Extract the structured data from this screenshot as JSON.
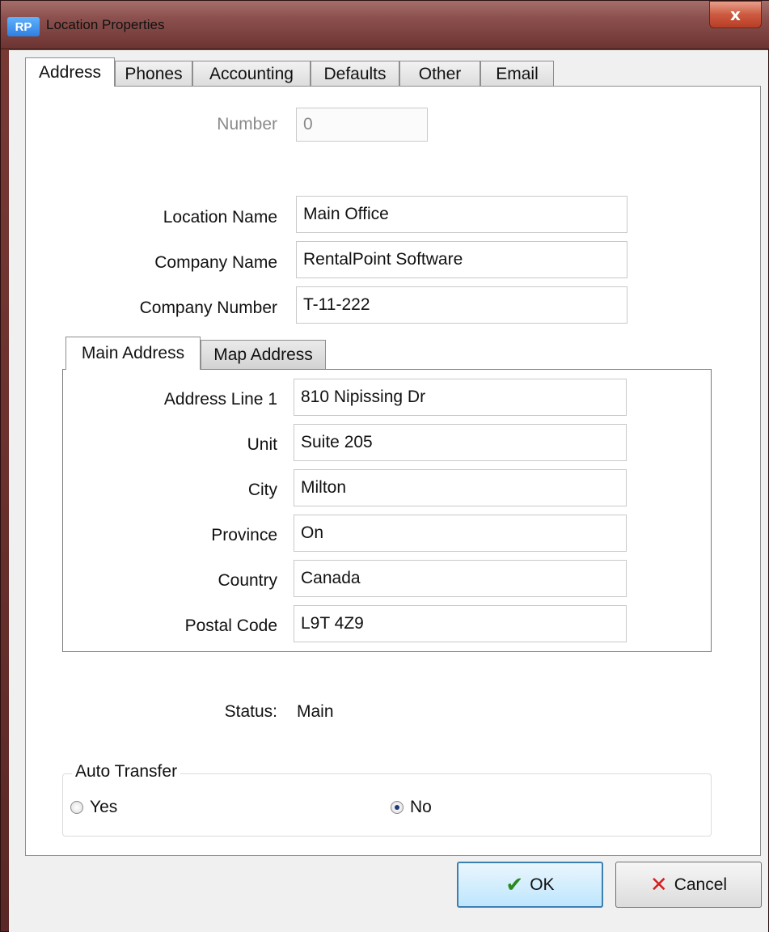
{
  "window": {
    "app_icon": "RP",
    "title": "Location Properties",
    "close_glyph": "x"
  },
  "tabs": [
    {
      "label": "Address",
      "active": true
    },
    {
      "label": "Phones",
      "active": false
    },
    {
      "label": "Accounting",
      "active": false
    },
    {
      "label": "Defaults",
      "active": false
    },
    {
      "label": "Other",
      "active": false
    },
    {
      "label": "Email",
      "active": false
    }
  ],
  "number": {
    "label": "Number",
    "value": "0"
  },
  "location_name": {
    "label": "Location Name",
    "value": "Main Office"
  },
  "company_name": {
    "label": "Company Name",
    "value": "RentalPoint Software"
  },
  "company_number": {
    "label": "Company Number",
    "value": "T-11-222"
  },
  "address_tabs": [
    {
      "label": "Main Address",
      "active": true
    },
    {
      "label": "Map Address",
      "active": false
    }
  ],
  "address": {
    "line1": {
      "label": "Address Line 1",
      "value": "810 Nipissing Dr"
    },
    "unit": {
      "label": "Unit",
      "value": "Suite 205"
    },
    "city": {
      "label": "City",
      "value": "Milton"
    },
    "province": {
      "label": "Province",
      "value": "On"
    },
    "country": {
      "label": "Country",
      "value": "Canada"
    },
    "postal_code": {
      "label": "Postal Code",
      "value": "L9T 4Z9"
    }
  },
  "status": {
    "label": "Status:",
    "value": "Main"
  },
  "auto_transfer": {
    "title": "Auto Transfer",
    "options": [
      {
        "label": "Yes",
        "checked": false
      },
      {
        "label": "No",
        "checked": true
      }
    ]
  },
  "buttons": {
    "ok_label": "OK",
    "cancel_label": "Cancel",
    "ok_icon": "checkmark-icon",
    "cancel_icon": "x-icon"
  },
  "colors": {
    "title_bar": "#8c514e",
    "close_button": "#cc5a40",
    "ok_button_border": "#3c7fb1",
    "checkmark": "#2a8a1e",
    "cancel_x": "#d42020"
  }
}
